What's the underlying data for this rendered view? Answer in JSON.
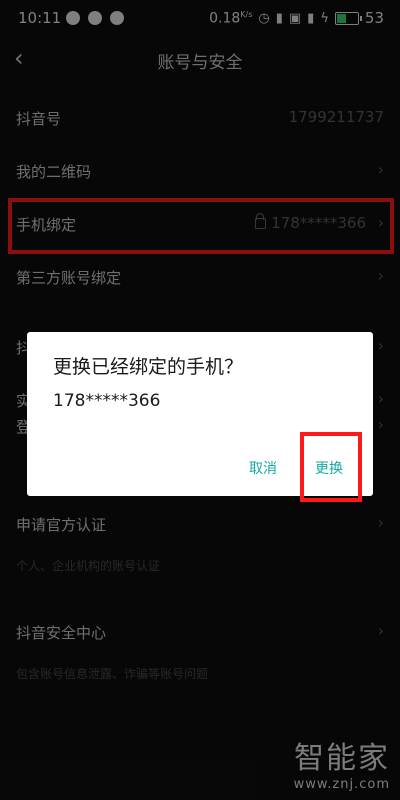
{
  "status_bar": {
    "time": "10:11",
    "speed": "0.18",
    "speed_unit": "K/s",
    "battery": "53",
    "battery_level_percent": 53,
    "battery_color": "#3bd16f"
  },
  "header": {
    "back_icon": "chevron-left-icon",
    "title": "账号与安全"
  },
  "settings": {
    "douyin_id_label": "抖音号",
    "douyin_id_value": "1799211737",
    "qr_code_label": "我的二维码",
    "phone_binding_label": "手机绑定",
    "phone_binding_value": "178*****366",
    "third_party_label": "第三方账号绑定",
    "hidden_row_1_label": "抖",
    "hidden_row_2_label": "实",
    "hidden_row_3_label": "登",
    "official_cert_label": "申请官方认证",
    "official_cert_sub": "个人、企业机构的账号认证",
    "security_center_label": "抖音安全中心",
    "security_center_sub": "包含账号信息泄露、诈骗等账号问题"
  },
  "dialog": {
    "title": "更换已经绑定的手机？",
    "phone": "178*****366",
    "cancel_label": "取消",
    "confirm_label": "更换",
    "accent_color": "#15a9a0"
  },
  "highlight_color": "#ff1a1a",
  "watermark": {
    "brand": "智能家",
    "url": "www.znj.com"
  }
}
